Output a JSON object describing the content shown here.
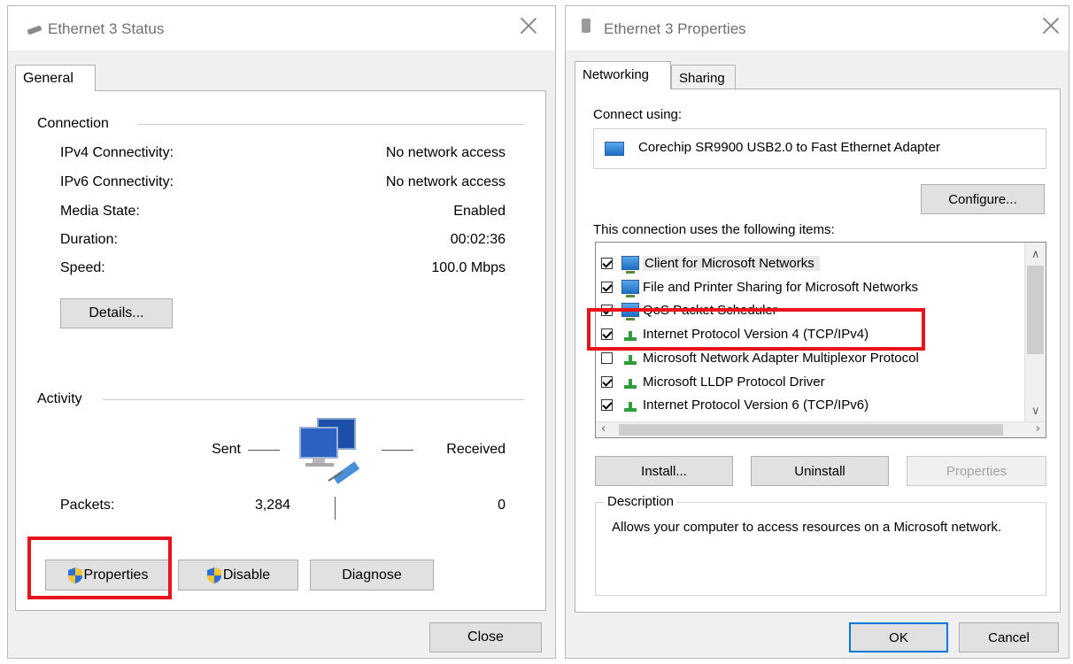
{
  "status_window": {
    "title": "Ethernet 3 Status",
    "tab": "General",
    "connection": {
      "group_label": "Connection",
      "rows": [
        {
          "label": "IPv4 Connectivity:",
          "value": "No network access"
        },
        {
          "label": "IPv6 Connectivity:",
          "value": "No network access"
        },
        {
          "label": "Media State:",
          "value": "Enabled"
        },
        {
          "label": "Duration:",
          "value": "00:02:36"
        },
        {
          "label": "Speed:",
          "value": "100.0 Mbps"
        }
      ],
      "details_button": "Details..."
    },
    "activity": {
      "group_label": "Activity",
      "sent_label": "Sent",
      "received_label": "Received",
      "packets_label": "Packets:",
      "packets_sent": "3,284",
      "packets_received": "0"
    },
    "buttons": {
      "properties": "Properties",
      "disable": "Disable",
      "diagnose": "Diagnose",
      "close": "Close"
    }
  },
  "properties_window": {
    "title": "Ethernet 3 Properties",
    "tabs": [
      "Networking",
      "Sharing"
    ],
    "connect_using_label": "Connect using:",
    "adapter_name": "Corechip SR9900 USB2.0 to Fast Ethernet Adapter",
    "configure_button": "Configure...",
    "items_label": "This connection uses the following items:",
    "items": [
      {
        "label": "Client for Microsoft Networks",
        "checked": true,
        "icon": "network-client-icon"
      },
      {
        "label": "File and Printer Sharing for Microsoft Networks",
        "checked": true,
        "icon": "network-service-icon"
      },
      {
        "label": "QoS Packet Scheduler",
        "checked": true,
        "icon": "network-service-icon"
      },
      {
        "label": "Internet Protocol Version 4 (TCP/IPv4)",
        "checked": true,
        "icon": "protocol-icon"
      },
      {
        "label": "Microsoft Network Adapter Multiplexor Protocol",
        "checked": false,
        "icon": "protocol-icon"
      },
      {
        "label": "Microsoft LLDP Protocol Driver",
        "checked": true,
        "icon": "protocol-icon"
      },
      {
        "label": "Internet Protocol Version 6 (TCP/IPv6)",
        "checked": true,
        "icon": "protocol-icon"
      }
    ],
    "buttons": {
      "install": "Install...",
      "uninstall": "Uninstall",
      "properties": "Properties",
      "ok": "OK",
      "cancel": "Cancel"
    },
    "description_label": "Description",
    "description_text": "Allows your computer to access resources on a Microsoft network.",
    "highlight_color": "#e8131b"
  }
}
